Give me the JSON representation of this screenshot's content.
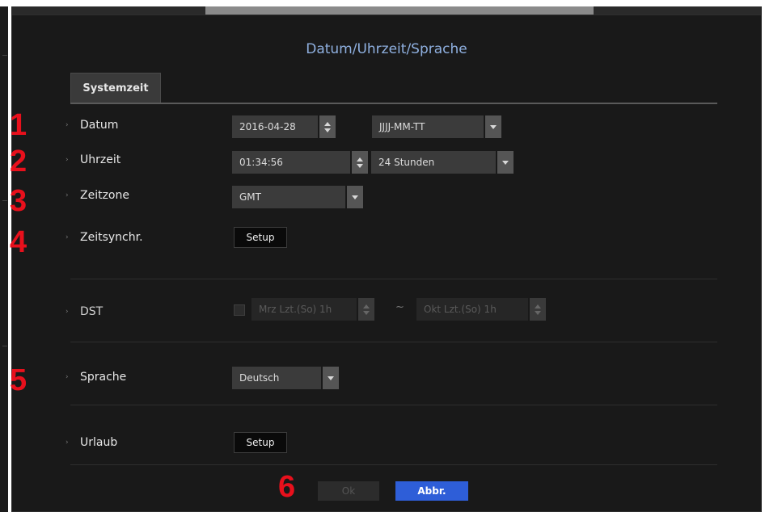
{
  "dialog": {
    "title": "Datum/Uhrzeit/Sprache"
  },
  "tabs": [
    {
      "label": "Systemzeit"
    }
  ],
  "callouts": [
    "1",
    "2",
    "3",
    "4",
    "5",
    "6"
  ],
  "rows": {
    "datum": {
      "label": "Datum",
      "date_value": "2016-04-28",
      "format_value": "JJJJ-MM-TT"
    },
    "uhrzeit": {
      "label": "Uhrzeit",
      "time_value": "01:34:56",
      "mode_value": "24 Stunden"
    },
    "zeitzone": {
      "label": "Zeitzone",
      "value": "GMT"
    },
    "zeitsynchr": {
      "label": "Zeitsynchr.",
      "button": "Setup"
    },
    "dst": {
      "label": "DST",
      "start_value": "Mrz Lzt.(So) 1h",
      "separator": "~",
      "end_value": "Okt Lzt.(So) 1h",
      "enabled": false
    },
    "sprache": {
      "label": "Sprache",
      "value": "Deutsch"
    },
    "urlaub": {
      "label": "Urlaub",
      "button": "Setup"
    }
  },
  "footer": {
    "ok_label": "Ok",
    "cancel_label": "Abbr."
  },
  "colors": {
    "title": "#8fb0e0",
    "callout": "#e8101c",
    "accent_button": "#2e5ed8",
    "background": "#191919"
  }
}
